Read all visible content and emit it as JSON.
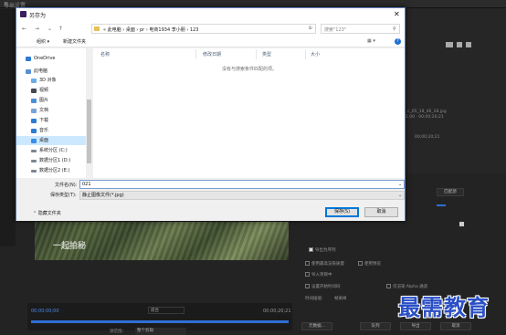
{
  "background_window": {
    "title": "导出设置",
    "close": "✕",
    "watermark": "一起拍秘",
    "timecode_left": "00;00;00;00",
    "timecode_right": "00;00;20;21",
    "fit": "适合",
    "source_range_label": "源范围:",
    "source_range_value": "整个剪辑",
    "right_panel_texts": [
      "c_05_18_46_28.jpg",
      "1.00 · 00;00;20;21",
      "00;00;20;21"
    ],
    "options": [
      "使用最高渲染质量",
      "使用预览",
      "导入项目中",
      "设置开始时间码",
      "仅渲染 Alpha 通道",
      "时间插值:",
      "帧采样"
    ],
    "export_as_sequence": "导出为序列",
    "bottom_buttons": [
      "元数据...",
      "队列",
      "导出",
      "取消"
    ],
    "reset_button": "匹配源"
  },
  "dialog": {
    "title": "另存为",
    "close": "✕",
    "breadcrumbs": "«  此电脑 › 桌面 › pr › 电商1934 李小朋 › 123",
    "search_placeholder": "搜索\"123\"",
    "organize": "组织 ▾",
    "new_folder": "新建文件夹",
    "nav_items": [
      {
        "label": "OneDrive",
        "icon": "cloud-icon",
        "color": "#2b7cd3"
      },
      {
        "label": "此电脑",
        "icon": "computer-icon",
        "color": "#5a8fd6"
      },
      {
        "label": "3D 对象",
        "icon": "cube-icon",
        "color": "#6aaee8"
      },
      {
        "label": "视频",
        "icon": "video-icon",
        "color": "#444a55"
      },
      {
        "label": "图片",
        "icon": "picture-icon",
        "color": "#4b8fd6"
      },
      {
        "label": "文档",
        "icon": "document-icon",
        "color": "#7aa2d8"
      },
      {
        "label": "下载",
        "icon": "download-icon",
        "color": "#2b7cd3"
      },
      {
        "label": "音乐",
        "icon": "music-icon",
        "color": "#2b7cd3"
      },
      {
        "label": "桌面",
        "icon": "desktop-icon",
        "color": "#3a8ee6",
        "selected": true
      },
      {
        "label": "系统分区 (C:)",
        "icon": "drive-icon",
        "color": "#7d8590"
      },
      {
        "label": "数据分区1 (D:)",
        "icon": "drive-icon",
        "color": "#7d8590"
      },
      {
        "label": "数据分区2 (E:)",
        "icon": "drive-icon",
        "color": "#7d8590"
      }
    ],
    "columns": [
      "名称",
      "修改日期",
      "类型",
      "大小"
    ],
    "empty_message": "没有与搜索条件匹配的项。",
    "filename_label": "文件名(N):",
    "filename_value": "021",
    "filetype_label": "保存类型(T):",
    "filetype_value": "静止图像文件(*.jpg)",
    "hide_folders": "隐藏文件夹",
    "save": "保存(S)",
    "cancel": "取消"
  },
  "brand": "最需教育"
}
